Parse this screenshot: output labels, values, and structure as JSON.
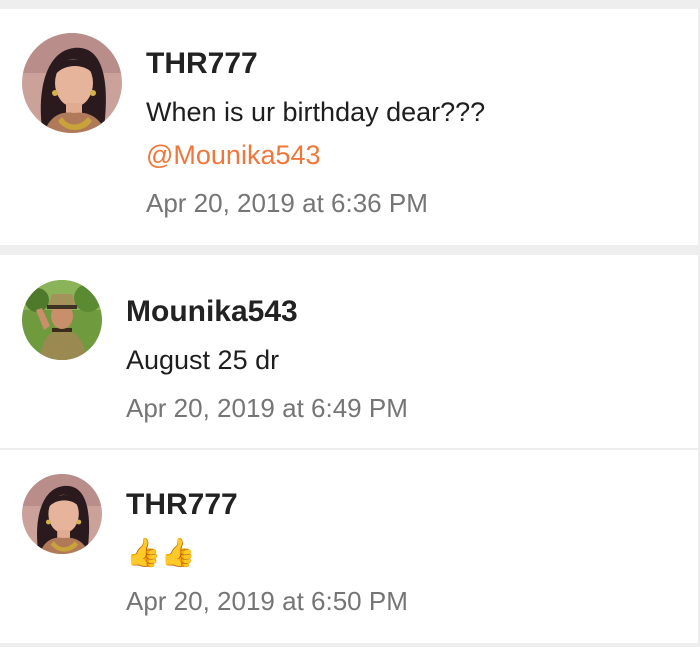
{
  "comments": [
    {
      "username": "THR777",
      "text": "When is ur birthday dear???",
      "mention": "@Mounika543",
      "timestamp": "Apr 20, 2019 at 6:36 PM",
      "avatar": "woman-portrait"
    },
    {
      "username": "Mounika543",
      "text": "August 25 dr",
      "timestamp": "Apr 20, 2019 at 6:49 PM",
      "avatar": "child-in-uniform-portrait"
    },
    {
      "username": "THR777",
      "text": "👍👍",
      "timestamp": "Apr 20, 2019 at 6:50 PM",
      "avatar": "woman-portrait"
    }
  ],
  "colors": {
    "mention": "#f0773a",
    "timestamp": "#757575",
    "username": "#222222",
    "divider": "#eeeeee"
  }
}
